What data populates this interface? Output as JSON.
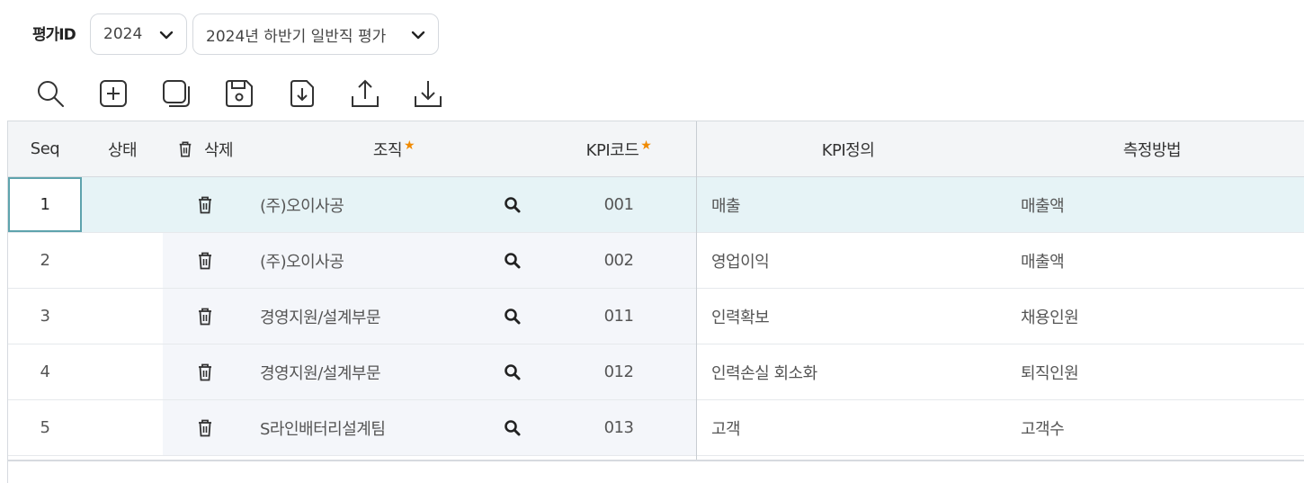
{
  "filter": {
    "label": "평가ID",
    "year": "2024",
    "evaluation": "2024년 하반기 일반직 평가"
  },
  "toolbar": [
    "search-icon",
    "add-icon",
    "copy-icon",
    "save-icon",
    "download-file-icon",
    "upload-icon",
    "export-download-icon"
  ],
  "grid": {
    "headers": {
      "seq": "Seq",
      "status": "상태",
      "delete": "삭제",
      "org": "조직",
      "kpi_code": "KPI코드",
      "kpi_def": "KPI정의",
      "measure": "측정방법"
    },
    "required_mark": "★",
    "rows": [
      {
        "seq": "1",
        "status": "",
        "org": "(주)오이사공",
        "kpi_code": "001",
        "kpi_def": "매출",
        "measure": "매출액"
      },
      {
        "seq": "2",
        "status": "",
        "org": "(주)오이사공",
        "kpi_code": "002",
        "kpi_def": "영업이익",
        "measure": "매출액"
      },
      {
        "seq": "3",
        "status": "",
        "org": "경영지원/설계부문",
        "kpi_code": "011",
        "kpi_def": "인력확보",
        "measure": "채용인원"
      },
      {
        "seq": "4",
        "status": "",
        "org": "경영지원/설계부문",
        "kpi_code": "012",
        "kpi_def": "인력손실 회소화",
        "measure": "퇴직인원"
      },
      {
        "seq": "5",
        "status": "",
        "org": "S라인배터리설계팀",
        "kpi_code": "013",
        "kpi_def": "고객",
        "measure": "고객수"
      }
    ]
  },
  "colors": {
    "accent_star": "#f08a00",
    "selected_row": "#e6f3f6",
    "selected_border": "#5ea3ad",
    "header_bg": "#f3f5f7"
  }
}
